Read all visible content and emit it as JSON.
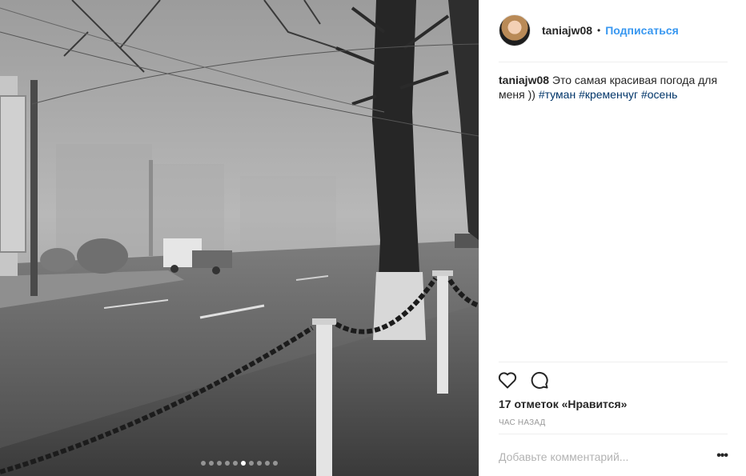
{
  "post": {
    "username": "taniajw08",
    "separator": "•",
    "follow_label": "Подписаться",
    "caption": {
      "username": "taniajw08",
      "text": "Это самая красивая погода для меня ))",
      "hashtags": [
        "#туман",
        "#кременчуг",
        "#осень"
      ]
    },
    "likes": "17 отметок «Нравится»",
    "timestamp": "ЧАС НАЗАД",
    "comment_placeholder": "Добавьте комментарий...",
    "more_label": "•••",
    "carousel": {
      "count": 10,
      "active_index": 5
    }
  },
  "icons": {
    "like": "heart-outline-icon",
    "comment": "speech-bubble-icon",
    "more": "more-options-icon"
  },
  "colors": {
    "link_blue": "#3897f0",
    "hashtag": "#003569",
    "muted": "#999999",
    "divider": "#efefef"
  }
}
